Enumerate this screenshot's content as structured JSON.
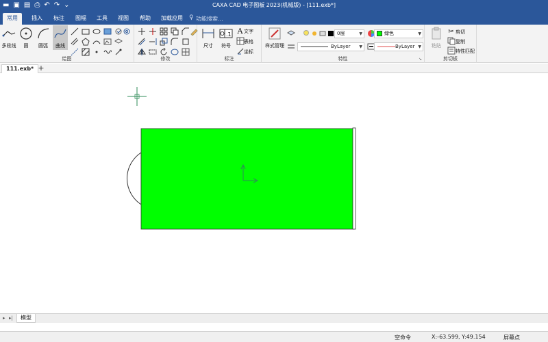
{
  "titlebar": {
    "title": "CAXA CAD 电子图板 2023(机械版) - [111.exb*]",
    "bg_color": "#2b579a"
  },
  "menu": {
    "tabs": [
      "常用",
      "插入",
      "标注",
      "图幅",
      "工具",
      "视图",
      "帮助",
      "加载应用"
    ],
    "active_tab": "常用",
    "search_placeholder": "功能搜索..."
  },
  "ribbon": {
    "draw": {
      "group_label": "绘图",
      "polyline": "多段线",
      "circle": "圆",
      "arc": "圆弧",
      "curve": "曲线"
    },
    "modify": {
      "group_label": "修改"
    },
    "annotate": {
      "group_label": "标注",
      "dimension": "尺寸",
      "symbol": "符号",
      "text": "文字",
      "table": "表格",
      "coordinate": "坐标"
    },
    "properties": {
      "group_label": "特性",
      "style_manager": "样式管理",
      "layer_value": "0层",
      "color_value": "绿色",
      "linetype_value": "ByLayer",
      "lineweight_value": "ByLayer"
    },
    "clipboard": {
      "group_label": "剪切板",
      "paste": "粘贴",
      "cut": "剪切",
      "copy": "复制",
      "match_properties": "特性匹配"
    }
  },
  "doc_tabs": {
    "active": "111.exb*",
    "add": "+"
  },
  "canvas": {
    "fill_color": "#00ff00"
  },
  "layout_tabs": {
    "model": "模型"
  },
  "status": {
    "command": "空命令",
    "coords": "X:-63.599, Y:49.154",
    "snap": "屏幕点"
  }
}
